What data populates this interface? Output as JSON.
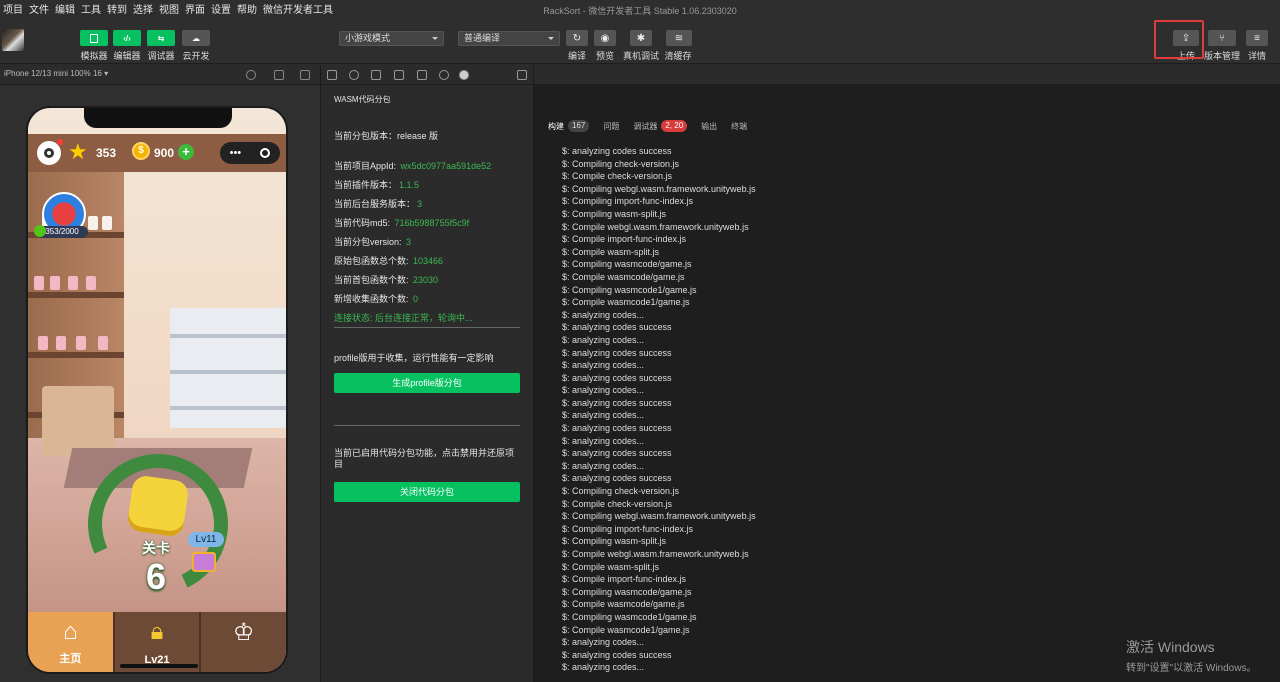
{
  "menu": {
    "items": [
      "项目",
      "文件",
      "编辑",
      "工具",
      "转到",
      "选择",
      "视图",
      "界面",
      "设置",
      "帮助",
      "微信开发者工具"
    ],
    "window_title": "RackSort - 微信开发者工具 Stable 1.06.2303020"
  },
  "toolbar": {
    "simulator": "模拟器",
    "editor": "编辑器",
    "debugger": "调试器",
    "cloud": "云开发",
    "mode_select": "小游戏模式",
    "compile_select": "普通编译",
    "compile": "编译",
    "preview": "预览",
    "real_debug": "真机调试",
    "clear_cache": "清缓存",
    "upload": "上传",
    "version_mgmt": "版本管理",
    "details": "详情"
  },
  "device": {
    "info": "iPhone 12/13 mini 100% 16 ▾"
  },
  "game": {
    "stars": "353",
    "coins": "900",
    "coin_symbol": "$",
    "progress": "353/2000",
    "level_label": "关卡",
    "level_number": "6",
    "lv_badge": "Lv11",
    "nav_home": "主页",
    "nav_level": "Lv21",
    "capsule_dots": "•••"
  },
  "wasm": {
    "title": "WASM代码分包",
    "rows": [
      {
        "label": "当前分包版本：",
        "value": "release 版",
        "plain": true
      },
      {
        "label": "当前项目AppId: ",
        "value": "wx5dc0977aa591de52"
      },
      {
        "label": "当前插件版本：",
        "value": "1.1.5"
      },
      {
        "label": "当前后台服务版本：",
        "value": "3"
      },
      {
        "label": "当前代码md5: ",
        "value": "716b5988755f5c9f"
      },
      {
        "label": "当前分包version: ",
        "value": "3"
      },
      {
        "label": "原始包函数总个数: ",
        "value": "103466"
      },
      {
        "label": "当前首包函数个数: ",
        "value": "23030"
      },
      {
        "label": "新增收集函数个数: ",
        "value": "0"
      }
    ],
    "status": "连接状态: 后台连接正常，轮询中...",
    "profile_note": "profile版用于收集，运行性能有一定影响",
    "profile_button": "生成profile版分包",
    "enabled_note": "当前已启用代码分包功能，点击禁用并还原项目",
    "close_button": "关闭代码分包"
  },
  "console": {
    "tabs": [
      {
        "label": "构建",
        "badge": "167"
      },
      {
        "label": "问题",
        "badge": ""
      },
      {
        "label": "调试器",
        "badge": "2, 20"
      },
      {
        "label": "输出",
        "badge": ""
      },
      {
        "label": "终端",
        "badge": ""
      }
    ],
    "lines": [
      "$: analyzing codes success",
      "$: Compiling check-version.js",
      "$: Compile check-version.js",
      "$: Compiling webgl.wasm.framework.unityweb.js",
      "$: Compiling import-func-index.js",
      "$: Compiling wasm-split.js",
      "$: Compile webgl.wasm.framework.unityweb.js",
      "$: Compile import-func-index.js",
      "$: Compile wasm-split.js",
      "$: Compiling wasmcode/game.js",
      "$: Compile wasmcode/game.js",
      "$: Compiling wasmcode1/game.js",
      "$: Compile wasmcode1/game.js",
      "$: analyzing codes...",
      "$: analyzing codes success",
      "$: analyzing codes...",
      "$: analyzing codes success",
      "$: analyzing codes...",
      "$: analyzing codes success",
      "$: analyzing codes...",
      "$: analyzing codes success",
      "$: analyzing codes...",
      "$: analyzing codes success",
      "$: analyzing codes...",
      "$: analyzing codes success",
      "$: analyzing codes...",
      "$: analyzing codes success",
      "$: Compiling check-version.js",
      "$: Compile check-version.js",
      "$: Compiling webgl.wasm.framework.unityweb.js",
      "$: Compiling import-func-index.js",
      "$: Compiling wasm-split.js",
      "$: Compile webgl.wasm.framework.unityweb.js",
      "$: Compile wasm-split.js",
      "$: Compile import-func-index.js",
      "$: Compiling wasmcode/game.js",
      "$: Compile wasmcode/game.js",
      "$: Compiling wasmcode1/game.js",
      "$: Compile wasmcode1/game.js",
      "$: analyzing codes...",
      "$: analyzing codes success",
      "$: analyzing codes..."
    ]
  },
  "activation": {
    "line1": "激活 Windows",
    "line2": "转到\"设置\"以激活 Windows。"
  }
}
